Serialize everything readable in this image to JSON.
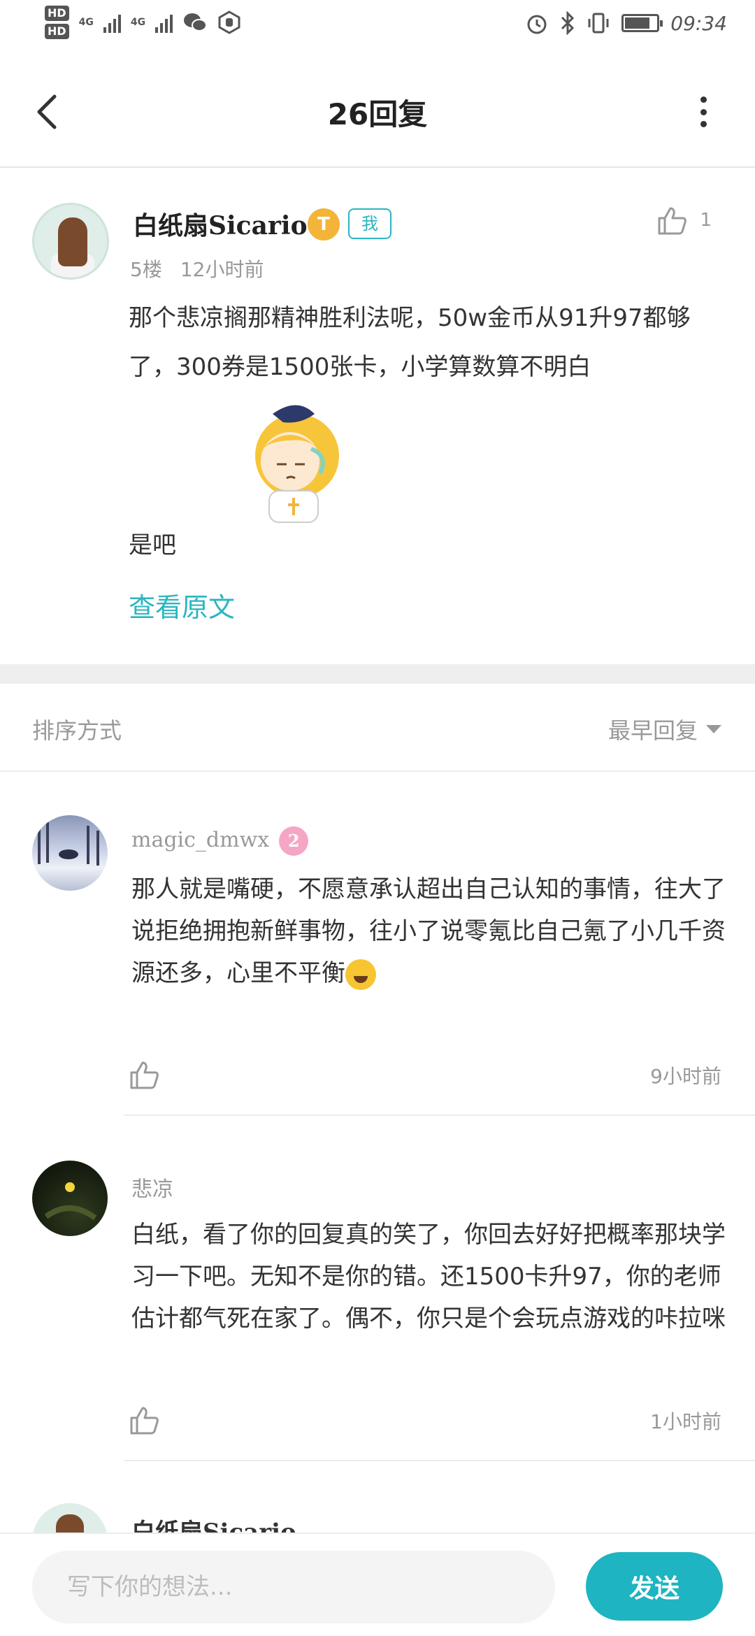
{
  "status_bar": {
    "hd1": "HD",
    "hd2": "HD",
    "net1": "4G",
    "net2": "4G",
    "time": "09:34",
    "battery_level": 0.8
  },
  "header": {
    "title": "26回复"
  },
  "post": {
    "username": "白纸扇Sicario",
    "badge_level": "T",
    "badge_me": "我",
    "like_count": "1",
    "floor": "5楼",
    "time": "12小时前",
    "text": "那个悲凉搁那精神胜利法呢，50w金币从91升97都够了，300券是1500张卡，小学算数算不明白",
    "text_tail": "是吧",
    "view_original": "查看原文"
  },
  "sort": {
    "label": "排序方式",
    "selected": "最早回复"
  },
  "replies": [
    {
      "username": "magic_dmwx",
      "level": "2",
      "text": "那人就是嘴硬，不愿意承认超出自己认知的事情，往大了说拒绝拥抱新鲜事物，往小了说零氪比自己氪了小几千资源还多，心里不平衡",
      "time": "9小时前"
    },
    {
      "username": "悲凉",
      "text": "白纸，看了你的回复真的笑了，你回去好好把概率那块学习一下吧。无知不是你的错。还1500卡升97，你的老师估计都气死在家了。偶不，你只是个会玩点游戏的咔拉咪",
      "time": "1小时前"
    },
    {
      "username": "白纸扇Sicario"
    }
  ],
  "composer": {
    "placeholder": "写下你的想法...",
    "send_label": "发送"
  },
  "colors": {
    "accent": "#1eb4c1",
    "badge_gold": "#f2b53a",
    "level_pink": "#f6a6c5"
  }
}
